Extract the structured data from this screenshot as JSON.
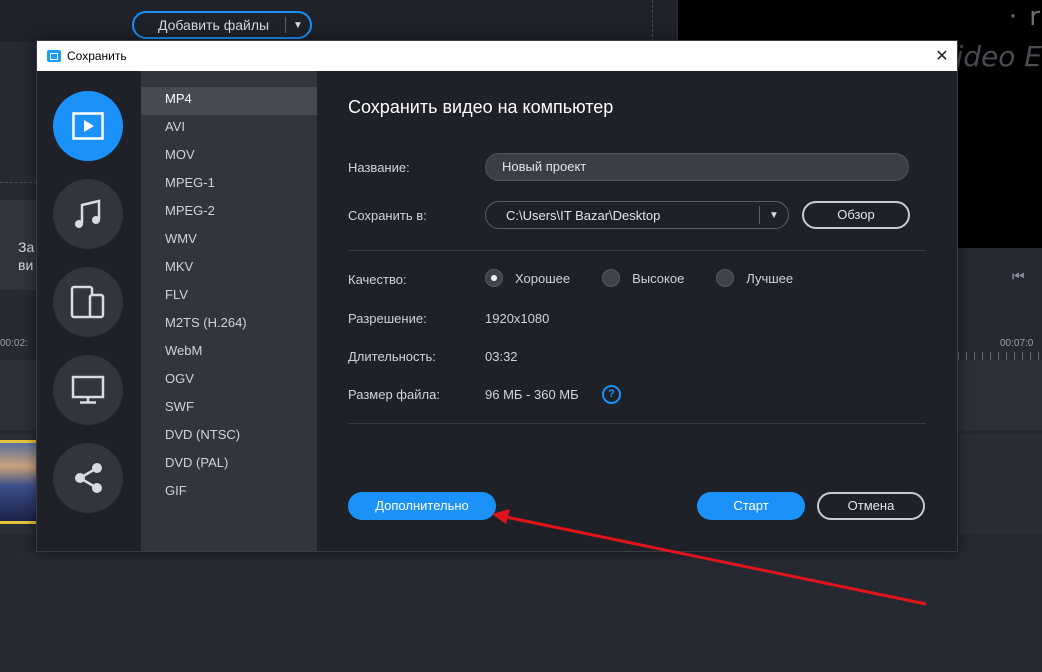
{
  "background": {
    "add_files_label": "Добавить файлы",
    "preview_logo": "· r",
    "preview_title": "Video E",
    "left_label": "За\nви",
    "time_left": "00:02:",
    "time_right": "00:07:0"
  },
  "dialog": {
    "title": "Сохранить",
    "close_glyph": "✕"
  },
  "categories": [
    {
      "name": "video",
      "active": true
    },
    {
      "name": "audio",
      "active": false
    },
    {
      "name": "devices",
      "active": false
    },
    {
      "name": "tv",
      "active": false
    },
    {
      "name": "share",
      "active": false
    }
  ],
  "formats": {
    "selected": "MP4",
    "items": [
      "MP4",
      "AVI",
      "MOV",
      "MPEG-1",
      "MPEG-2",
      "WMV",
      "MKV",
      "FLV",
      "M2TS (H.264)",
      "WebM",
      "OGV",
      "SWF",
      "DVD (NTSC)",
      "DVD (PAL)",
      "GIF"
    ]
  },
  "form": {
    "heading": "Сохранить видео на компьютер",
    "name_label": "Название:",
    "name_value": "Новый проект",
    "save_to_label": "Сохранить в:",
    "save_to_value": "C:\\Users\\IT Bazar\\Desktop",
    "browse_label": "Обзор",
    "quality_label": "Качество:",
    "quality_options": [
      "Хорошее",
      "Высокое",
      "Лучшее"
    ],
    "quality_selected": "Хорошее",
    "resolution_label": "Разрешение:",
    "resolution_value": "1920x1080",
    "duration_label": "Длительность:",
    "duration_value": "03:32",
    "filesize_label": "Размер файла:",
    "filesize_value": "96 МБ - 360 МБ",
    "help_glyph": "?",
    "advanced_label": "Дополнительно",
    "start_label": "Старт",
    "cancel_label": "Отмена"
  },
  "colors": {
    "accent": "#1b92fa",
    "annotation_arrow": "#e0141a"
  }
}
